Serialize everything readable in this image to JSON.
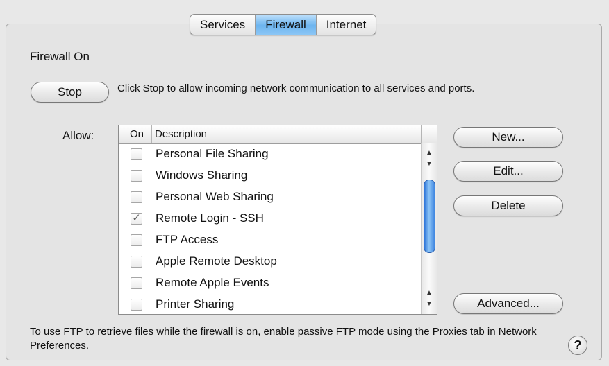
{
  "tabs": [
    {
      "label": "Services",
      "selected": false
    },
    {
      "label": "Firewall",
      "selected": true
    },
    {
      "label": "Internet",
      "selected": false
    }
  ],
  "firewall": {
    "status_title": "Firewall On",
    "stop_button": "Stop",
    "stop_description": "Click Stop to allow incoming network communication to all services and ports."
  },
  "allow": {
    "label": "Allow:",
    "columns": [
      "On",
      "Description"
    ],
    "rows": [
      {
        "label": "Personal File Sharing",
        "checked": false
      },
      {
        "label": "Windows Sharing",
        "checked": false
      },
      {
        "label": "Personal Web Sharing",
        "checked": false
      },
      {
        "label": "Remote Login - SSH",
        "checked": true
      },
      {
        "label": "FTP Access",
        "checked": false
      },
      {
        "label": "Apple Remote Desktop",
        "checked": false
      },
      {
        "label": "Remote Apple Events",
        "checked": false
      },
      {
        "label": "Printer Sharing",
        "checked": false
      }
    ]
  },
  "buttons": {
    "new": "New...",
    "edit": "Edit...",
    "delete": "Delete",
    "advanced": "Advanced..."
  },
  "footer": "To use FTP to retrieve files while the firewall is on, enable passive FTP mode using the Proxies tab in Network Preferences.",
  "help": "?",
  "colors": {
    "selected_tab": "#6cb4ef",
    "scroll_thumb": "#3f86e0"
  },
  "icons": {
    "check": "✓",
    "scroll_up": "▲",
    "scroll_down": "▼"
  }
}
